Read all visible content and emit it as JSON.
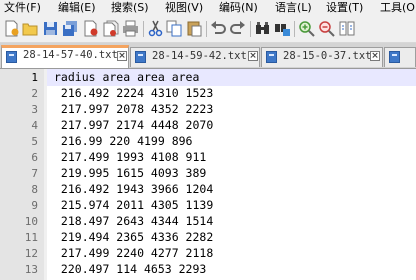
{
  "menu": [
    "文件(F)",
    "编辑(E)",
    "搜索(S)",
    "视图(V)",
    "编码(N)",
    "语言(L)",
    "设置(T)",
    "工具(O)"
  ],
  "toolbar_icons": [
    "new-file-icon",
    "open-file-icon",
    "save-icon",
    "save-all-icon",
    "close-icon",
    "close-all-icon",
    "print-icon",
    "cut-icon",
    "copy-icon",
    "paste-icon",
    "undo-icon",
    "redo-icon",
    "find-icon",
    "replace-icon",
    "zoom-in-icon",
    "zoom-out-icon",
    "sync-scroll-icon"
  ],
  "tabs": [
    {
      "label": "28-14-57-40.txt",
      "active": true
    },
    {
      "label": "28-14-59-42.txt",
      "active": false
    },
    {
      "label": "28-15-0-37.txt",
      "active": false
    },
    {
      "label": "",
      "active": false
    }
  ],
  "editor": {
    "line_numbers": [
      "1",
      "2",
      "3",
      "4",
      "5",
      "6",
      "7",
      "8",
      "9",
      "10",
      "11",
      "12",
      "13"
    ],
    "lines": [
      "radius area area area",
      " 216.492 2224 4310 1523",
      " 217.997 2078 4352 2223",
      " 217.997 2174 4448 2070",
      " 216.99 220 4199 896",
      " 217.499 1993 4108 911",
      " 219.995 1615 4093 389",
      " 216.492 1943 3966 1204",
      " 215.974 2011 4305 1139",
      " 218.497 2643 4344 1514",
      " 219.494 2365 4336 2282",
      " 217.499 2240 4277 2118",
      " 220.497 114 4653 2293"
    ]
  }
}
